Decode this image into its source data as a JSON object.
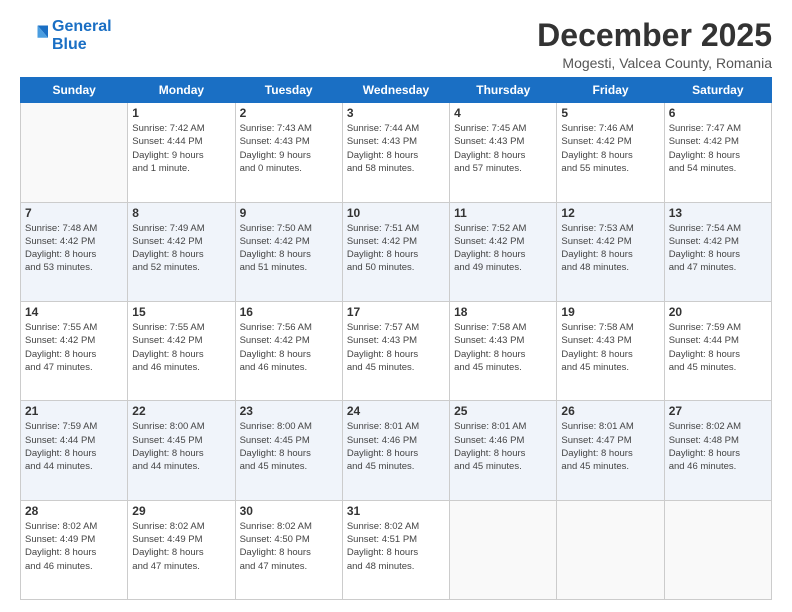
{
  "logo": {
    "line1": "General",
    "line2": "Blue"
  },
  "title": "December 2025",
  "subtitle": "Mogesti, Valcea County, Romania",
  "days_header": [
    "Sunday",
    "Monday",
    "Tuesday",
    "Wednesday",
    "Thursday",
    "Friday",
    "Saturday"
  ],
  "weeks": [
    [
      {
        "day": "",
        "info": ""
      },
      {
        "day": "1",
        "info": "Sunrise: 7:42 AM\nSunset: 4:44 PM\nDaylight: 9 hours\nand 1 minute."
      },
      {
        "day": "2",
        "info": "Sunrise: 7:43 AM\nSunset: 4:43 PM\nDaylight: 9 hours\nand 0 minutes."
      },
      {
        "day": "3",
        "info": "Sunrise: 7:44 AM\nSunset: 4:43 PM\nDaylight: 8 hours\nand 58 minutes."
      },
      {
        "day": "4",
        "info": "Sunrise: 7:45 AM\nSunset: 4:43 PM\nDaylight: 8 hours\nand 57 minutes."
      },
      {
        "day": "5",
        "info": "Sunrise: 7:46 AM\nSunset: 4:42 PM\nDaylight: 8 hours\nand 55 minutes."
      },
      {
        "day": "6",
        "info": "Sunrise: 7:47 AM\nSunset: 4:42 PM\nDaylight: 8 hours\nand 54 minutes."
      }
    ],
    [
      {
        "day": "7",
        "info": "Sunrise: 7:48 AM\nSunset: 4:42 PM\nDaylight: 8 hours\nand 53 minutes."
      },
      {
        "day": "8",
        "info": "Sunrise: 7:49 AM\nSunset: 4:42 PM\nDaylight: 8 hours\nand 52 minutes."
      },
      {
        "day": "9",
        "info": "Sunrise: 7:50 AM\nSunset: 4:42 PM\nDaylight: 8 hours\nand 51 minutes."
      },
      {
        "day": "10",
        "info": "Sunrise: 7:51 AM\nSunset: 4:42 PM\nDaylight: 8 hours\nand 50 minutes."
      },
      {
        "day": "11",
        "info": "Sunrise: 7:52 AM\nSunset: 4:42 PM\nDaylight: 8 hours\nand 49 minutes."
      },
      {
        "day": "12",
        "info": "Sunrise: 7:53 AM\nSunset: 4:42 PM\nDaylight: 8 hours\nand 48 minutes."
      },
      {
        "day": "13",
        "info": "Sunrise: 7:54 AM\nSunset: 4:42 PM\nDaylight: 8 hours\nand 47 minutes."
      }
    ],
    [
      {
        "day": "14",
        "info": "Sunrise: 7:55 AM\nSunset: 4:42 PM\nDaylight: 8 hours\nand 47 minutes."
      },
      {
        "day": "15",
        "info": "Sunrise: 7:55 AM\nSunset: 4:42 PM\nDaylight: 8 hours\nand 46 minutes."
      },
      {
        "day": "16",
        "info": "Sunrise: 7:56 AM\nSunset: 4:42 PM\nDaylight: 8 hours\nand 46 minutes."
      },
      {
        "day": "17",
        "info": "Sunrise: 7:57 AM\nSunset: 4:43 PM\nDaylight: 8 hours\nand 45 minutes."
      },
      {
        "day": "18",
        "info": "Sunrise: 7:58 AM\nSunset: 4:43 PM\nDaylight: 8 hours\nand 45 minutes."
      },
      {
        "day": "19",
        "info": "Sunrise: 7:58 AM\nSunset: 4:43 PM\nDaylight: 8 hours\nand 45 minutes."
      },
      {
        "day": "20",
        "info": "Sunrise: 7:59 AM\nSunset: 4:44 PM\nDaylight: 8 hours\nand 45 minutes."
      }
    ],
    [
      {
        "day": "21",
        "info": "Sunrise: 7:59 AM\nSunset: 4:44 PM\nDaylight: 8 hours\nand 44 minutes."
      },
      {
        "day": "22",
        "info": "Sunrise: 8:00 AM\nSunset: 4:45 PM\nDaylight: 8 hours\nand 44 minutes."
      },
      {
        "day": "23",
        "info": "Sunrise: 8:00 AM\nSunset: 4:45 PM\nDaylight: 8 hours\nand 45 minutes."
      },
      {
        "day": "24",
        "info": "Sunrise: 8:01 AM\nSunset: 4:46 PM\nDaylight: 8 hours\nand 45 minutes."
      },
      {
        "day": "25",
        "info": "Sunrise: 8:01 AM\nSunset: 4:46 PM\nDaylight: 8 hours\nand 45 minutes."
      },
      {
        "day": "26",
        "info": "Sunrise: 8:01 AM\nSunset: 4:47 PM\nDaylight: 8 hours\nand 45 minutes."
      },
      {
        "day": "27",
        "info": "Sunrise: 8:02 AM\nSunset: 4:48 PM\nDaylight: 8 hours\nand 46 minutes."
      }
    ],
    [
      {
        "day": "28",
        "info": "Sunrise: 8:02 AM\nSunset: 4:49 PM\nDaylight: 8 hours\nand 46 minutes."
      },
      {
        "day": "29",
        "info": "Sunrise: 8:02 AM\nSunset: 4:49 PM\nDaylight: 8 hours\nand 47 minutes."
      },
      {
        "day": "30",
        "info": "Sunrise: 8:02 AM\nSunset: 4:50 PM\nDaylight: 8 hours\nand 47 minutes."
      },
      {
        "day": "31",
        "info": "Sunrise: 8:02 AM\nSunset: 4:51 PM\nDaylight: 8 hours\nand 48 minutes."
      },
      {
        "day": "",
        "info": ""
      },
      {
        "day": "",
        "info": ""
      },
      {
        "day": "",
        "info": ""
      }
    ]
  ]
}
